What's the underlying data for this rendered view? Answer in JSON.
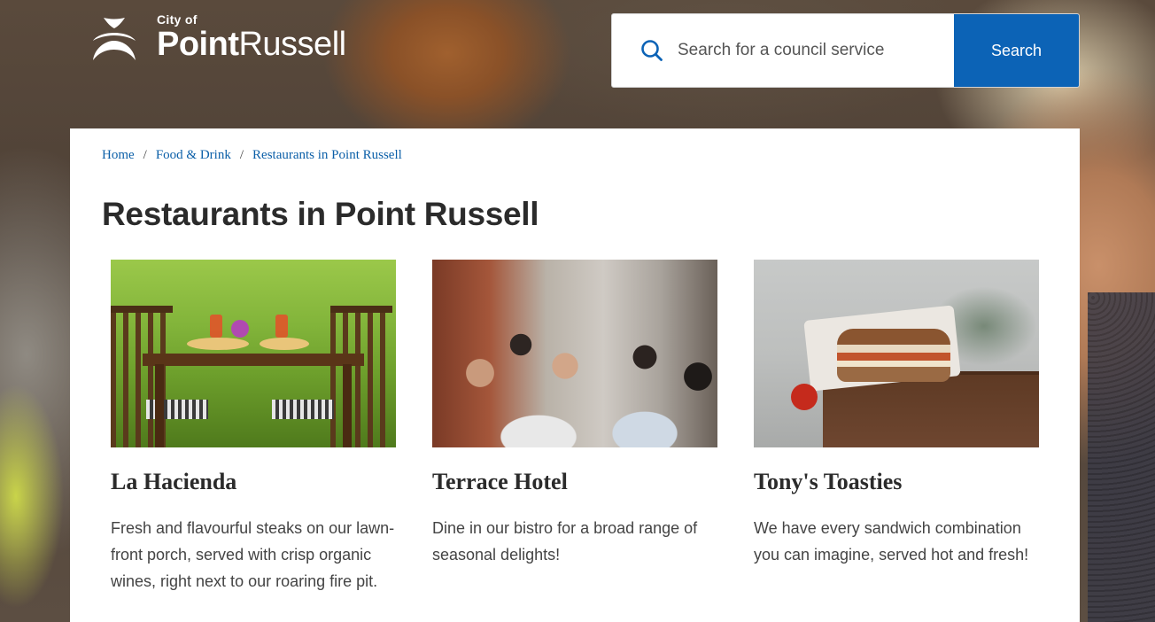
{
  "header": {
    "logo": {
      "small_text": "City of",
      "name_bold": "Point",
      "name_regular": "Russell",
      "icon": "city-logo-icon"
    },
    "search": {
      "placeholder": "Search for a council service",
      "value": "",
      "button_label": "Search",
      "icon": "search-icon"
    }
  },
  "breadcrumb": [
    {
      "label": "Home"
    },
    {
      "label": "Food & Drink"
    },
    {
      "label": "Restaurants in Point Russell"
    }
  ],
  "breadcrumb_separator": "/",
  "page_title": "Restaurants in Point Russell",
  "cards": [
    {
      "title": "La Hacienda",
      "description": "Fresh and flavourful steaks on our lawn-front porch, served with crisp organic wines, right next to our roaring fire pit."
    },
    {
      "title": "Terrace Hotel",
      "description": "Dine in our bistro for a broad range of seasonal delights!"
    },
    {
      "title": "Tony's Toasties",
      "description": "We have every sandwich combination you can imagine, served hot and fresh!"
    }
  ],
  "colors": {
    "accent": "#0c63b6",
    "link": "#0b5fa8",
    "title_text": "#2b2b2b",
    "body_text": "#444444"
  }
}
